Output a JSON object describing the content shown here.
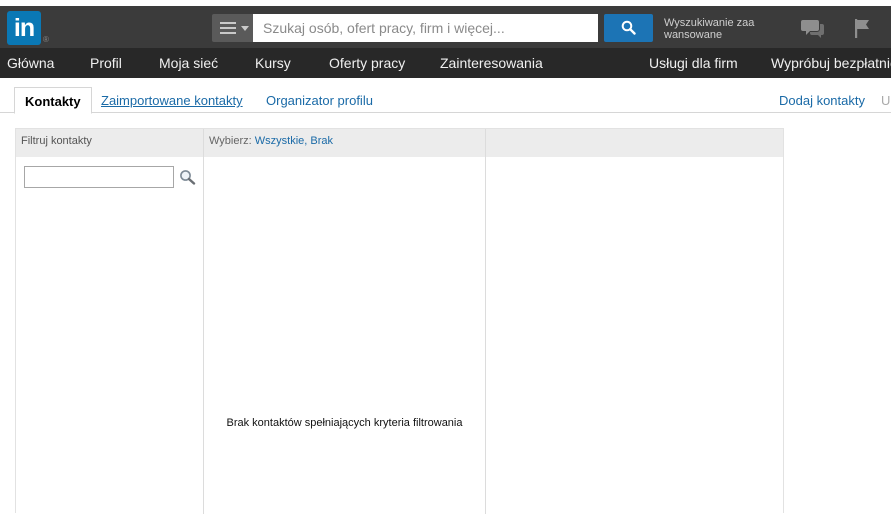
{
  "topbar": {
    "logo_text": "in",
    "logo_reg": "®",
    "search_placeholder": "Szukaj osób, ofert pracy, firm i więcej...",
    "advanced_search": "Wyszukiwanie zaa wansowane",
    "colors": {
      "topbar_bg": "#3b3b3b",
      "logo_bg": "#0a78b5",
      "search_button_bg": "#1c74b5"
    }
  },
  "nav": {
    "items": [
      "Główna",
      "Profil",
      "Moja sieć",
      "Kursy",
      "Oferty pracy",
      "Zainteresowania",
      "Usługi dla firm",
      "Wypróbuj bezpłatnie"
    ]
  },
  "tabs": {
    "contacts": "Kontakty",
    "imported": "Zaimportowane kontakty",
    "organizer": "Organizator profilu",
    "add_contacts": "Dodaj kontakty",
    "truncated": "U"
  },
  "panel": {
    "filter_label": "Filtruj kontakty",
    "select_label": "Wybierz:",
    "select_all": "Wszystkie",
    "select_sep": ",",
    "select_none": "Brak",
    "filter_value": "",
    "empty_message": "Brak kontaktów spełniających kryteria filtrowania"
  }
}
